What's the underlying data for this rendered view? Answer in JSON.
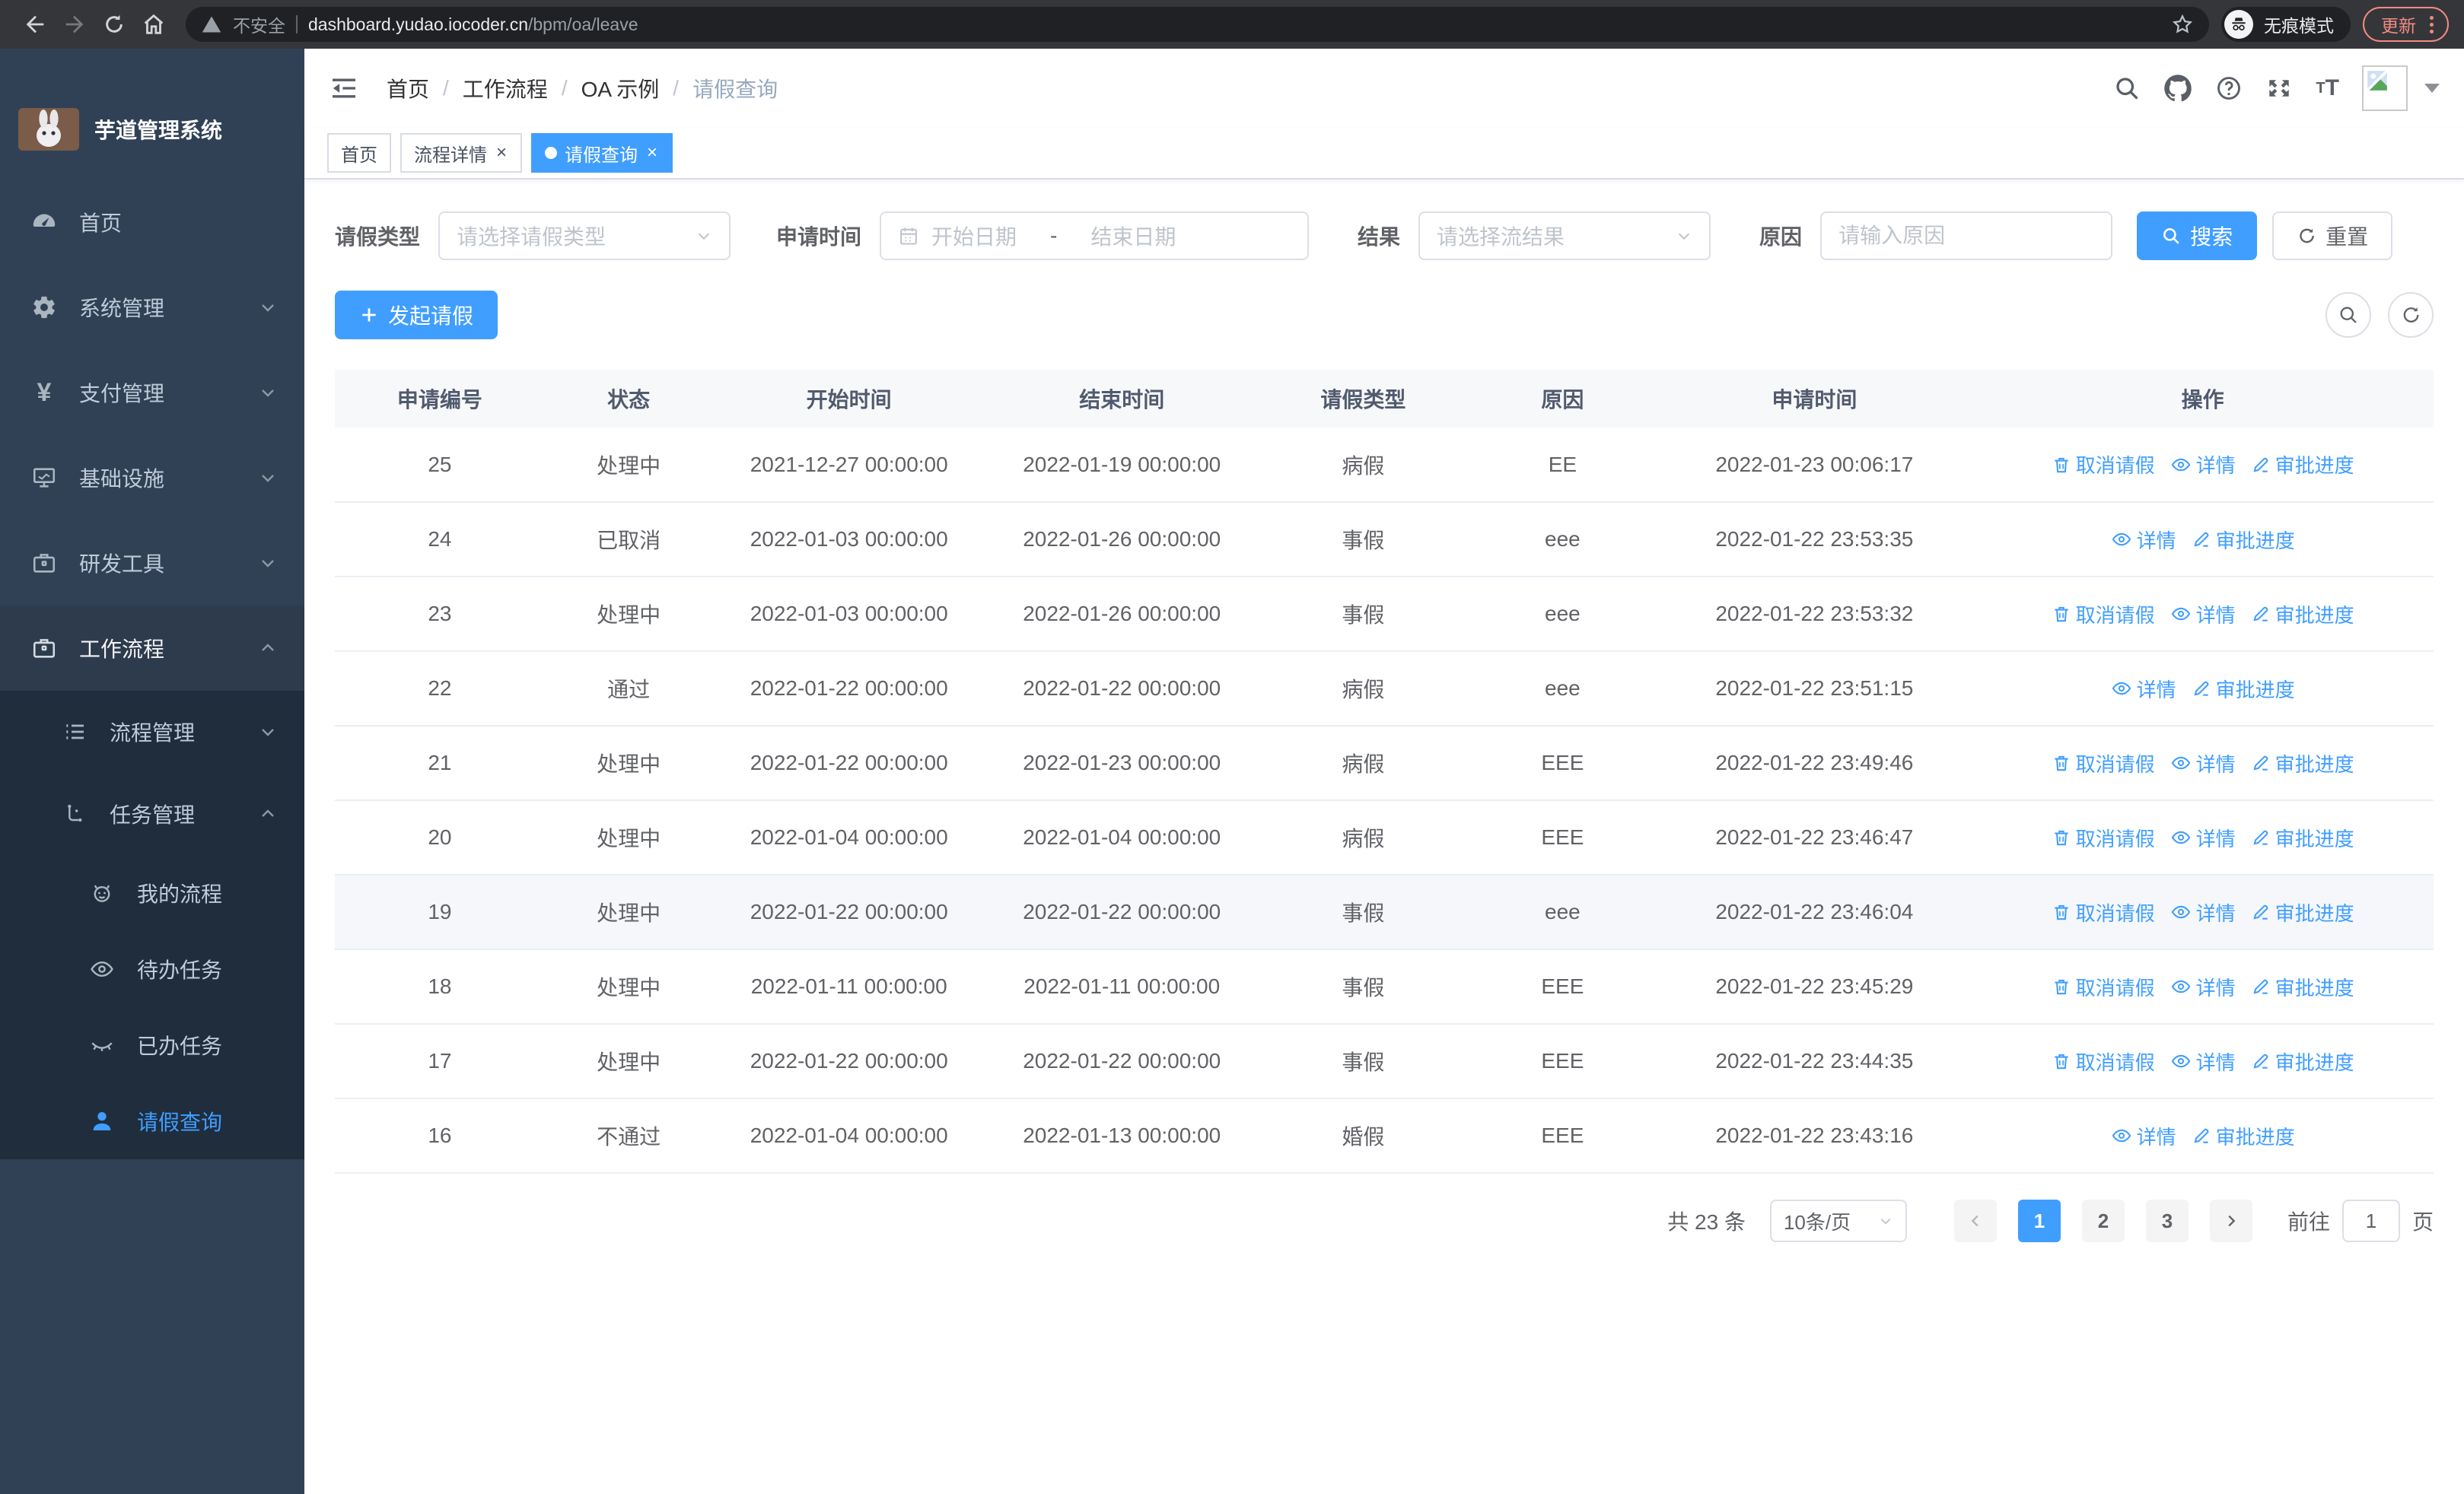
{
  "browser": {
    "security_label": "不安全",
    "url_host": "dashboard.yudao.iocoder.cn",
    "url_path": "/bpm/oa/leave",
    "incognito_label": "无痕模式",
    "update_label": "更新",
    "nav_icons": [
      "back-arrow",
      "forward-arrow",
      "reload",
      "home",
      "warning",
      "star",
      "incognito",
      "more-dots"
    ]
  },
  "colors": {
    "primary": "#409eff",
    "sidebar_bg": "#304156",
    "submenu_bg": "#1f2d3d",
    "sidebar_text": "#bfcbd9",
    "update_chip": "#f28b82",
    "table_header_bg": "#f7f8fa",
    "row_border": "#ebeef5"
  },
  "sidebar": {
    "app_title": "芋道管理系统",
    "menu": [
      {
        "label": "首页",
        "icon": "dashboard-icon"
      },
      {
        "label": "系统管理",
        "icon": "gear-icon",
        "state": "collapsed"
      },
      {
        "label": "支付管理",
        "icon": "yen-icon",
        "state": "collapsed"
      },
      {
        "label": "基础设施",
        "icon": "monitor-icon",
        "state": "collapsed"
      },
      {
        "label": "研发工具",
        "icon": "toolbox-icon",
        "state": "collapsed"
      },
      {
        "label": "工作流程",
        "icon": "briefcase-icon",
        "state": "expanded"
      }
    ],
    "submenu": [
      {
        "label": "流程管理",
        "icon": "list-icon",
        "state": "collapsed"
      },
      {
        "label": "任务管理",
        "icon": "tree-icon",
        "state": "expanded"
      }
    ],
    "children": [
      {
        "label": "我的流程",
        "icon": "robot-icon"
      },
      {
        "label": "待办任务",
        "icon": "eye-icon"
      },
      {
        "label": "已办任务",
        "icon": "eye-closed-icon"
      },
      {
        "label": "请假查询",
        "icon": "user-icon",
        "active": true
      }
    ]
  },
  "header": {
    "breadcrumb": [
      "首页",
      "工作流程",
      "OA 示例",
      "请假查询"
    ],
    "tool_icons": [
      "collapse-sidebar",
      "search",
      "github",
      "help",
      "fullscreen",
      "font-size",
      "avatar",
      "caret-down"
    ]
  },
  "tabs": {
    "items": [
      {
        "label": "首页",
        "closable": false,
        "active": false
      },
      {
        "label": "流程详情",
        "closable": true,
        "active": false
      },
      {
        "label": "请假查询",
        "closable": true,
        "active": true
      }
    ]
  },
  "filters": {
    "leave_type_label": "请假类型",
    "leave_type_placeholder": "请选择请假类型",
    "apply_time_label": "申请时间",
    "start_date_placeholder": "开始日期",
    "range_separator": "-",
    "end_date_placeholder": "结束日期",
    "result_label": "结果",
    "result_placeholder": "请选择流结果",
    "reason_label": "原因",
    "reason_placeholder": "请输入原因",
    "search_label": "搜索",
    "reset_label": "重置"
  },
  "toolbar": {
    "create_label": "发起请假"
  },
  "row_actions": {
    "cancel": "取消请假",
    "detail": "详情",
    "progress": "审批进度"
  },
  "table": {
    "columns": [
      "申请编号",
      "状态",
      "开始时间",
      "结束时间",
      "请假类型",
      "原因",
      "申请时间",
      "操作"
    ],
    "rows": [
      {
        "id": "25",
        "status": "处理中",
        "start": "2021-12-27 00:00:00",
        "end": "2022-01-19 00:00:00",
        "type": "病假",
        "reason": "EE",
        "applied": "2022-01-23 00:06:17",
        "cancel": true
      },
      {
        "id": "24",
        "status": "已取消",
        "start": "2022-01-03 00:00:00",
        "end": "2022-01-26 00:00:00",
        "type": "事假",
        "reason": "eee",
        "applied": "2022-01-22 23:53:35",
        "cancel": false
      },
      {
        "id": "23",
        "status": "处理中",
        "start": "2022-01-03 00:00:00",
        "end": "2022-01-26 00:00:00",
        "type": "事假",
        "reason": "eee",
        "applied": "2022-01-22 23:53:32",
        "cancel": true
      },
      {
        "id": "22",
        "status": "通过",
        "start": "2022-01-22 00:00:00",
        "end": "2022-01-22 00:00:00",
        "type": "病假",
        "reason": "eee",
        "applied": "2022-01-22 23:51:15",
        "cancel": false
      },
      {
        "id": "21",
        "status": "处理中",
        "start": "2022-01-22 00:00:00",
        "end": "2022-01-23 00:00:00",
        "type": "病假",
        "reason": "EEE",
        "applied": "2022-01-22 23:49:46",
        "cancel": true
      },
      {
        "id": "20",
        "status": "处理中",
        "start": "2022-01-04 00:00:00",
        "end": "2022-01-04 00:00:00",
        "type": "病假",
        "reason": "EEE",
        "applied": "2022-01-22 23:46:47",
        "cancel": true
      },
      {
        "id": "19",
        "status": "处理中",
        "start": "2022-01-22 00:00:00",
        "end": "2022-01-22 00:00:00",
        "type": "事假",
        "reason": "eee",
        "applied": "2022-01-22 23:46:04",
        "cancel": true,
        "_class": "hl"
      },
      {
        "id": "18",
        "status": "处理中",
        "start": "2022-01-11 00:00:00",
        "end": "2022-01-11 00:00:00",
        "type": "事假",
        "reason": "EEE",
        "applied": "2022-01-22 23:45:29",
        "cancel": true
      },
      {
        "id": "17",
        "status": "处理中",
        "start": "2022-01-22 00:00:00",
        "end": "2022-01-22 00:00:00",
        "type": "事假",
        "reason": "EEE",
        "applied": "2022-01-22 23:44:35",
        "cancel": true
      },
      {
        "id": "16",
        "status": "不通过",
        "start": "2022-01-04 00:00:00",
        "end": "2022-01-13 00:00:00",
        "type": "婚假",
        "reason": "EEE",
        "applied": "2022-01-22 23:43:16",
        "cancel": false
      }
    ]
  },
  "pagination": {
    "total_label": "共 23 条",
    "size_label": "10条/页",
    "pages": [
      "1",
      "2",
      "3"
    ],
    "active_page": "1",
    "goto_label": "前往",
    "goto_value": "1",
    "goto_suffix": "页"
  }
}
